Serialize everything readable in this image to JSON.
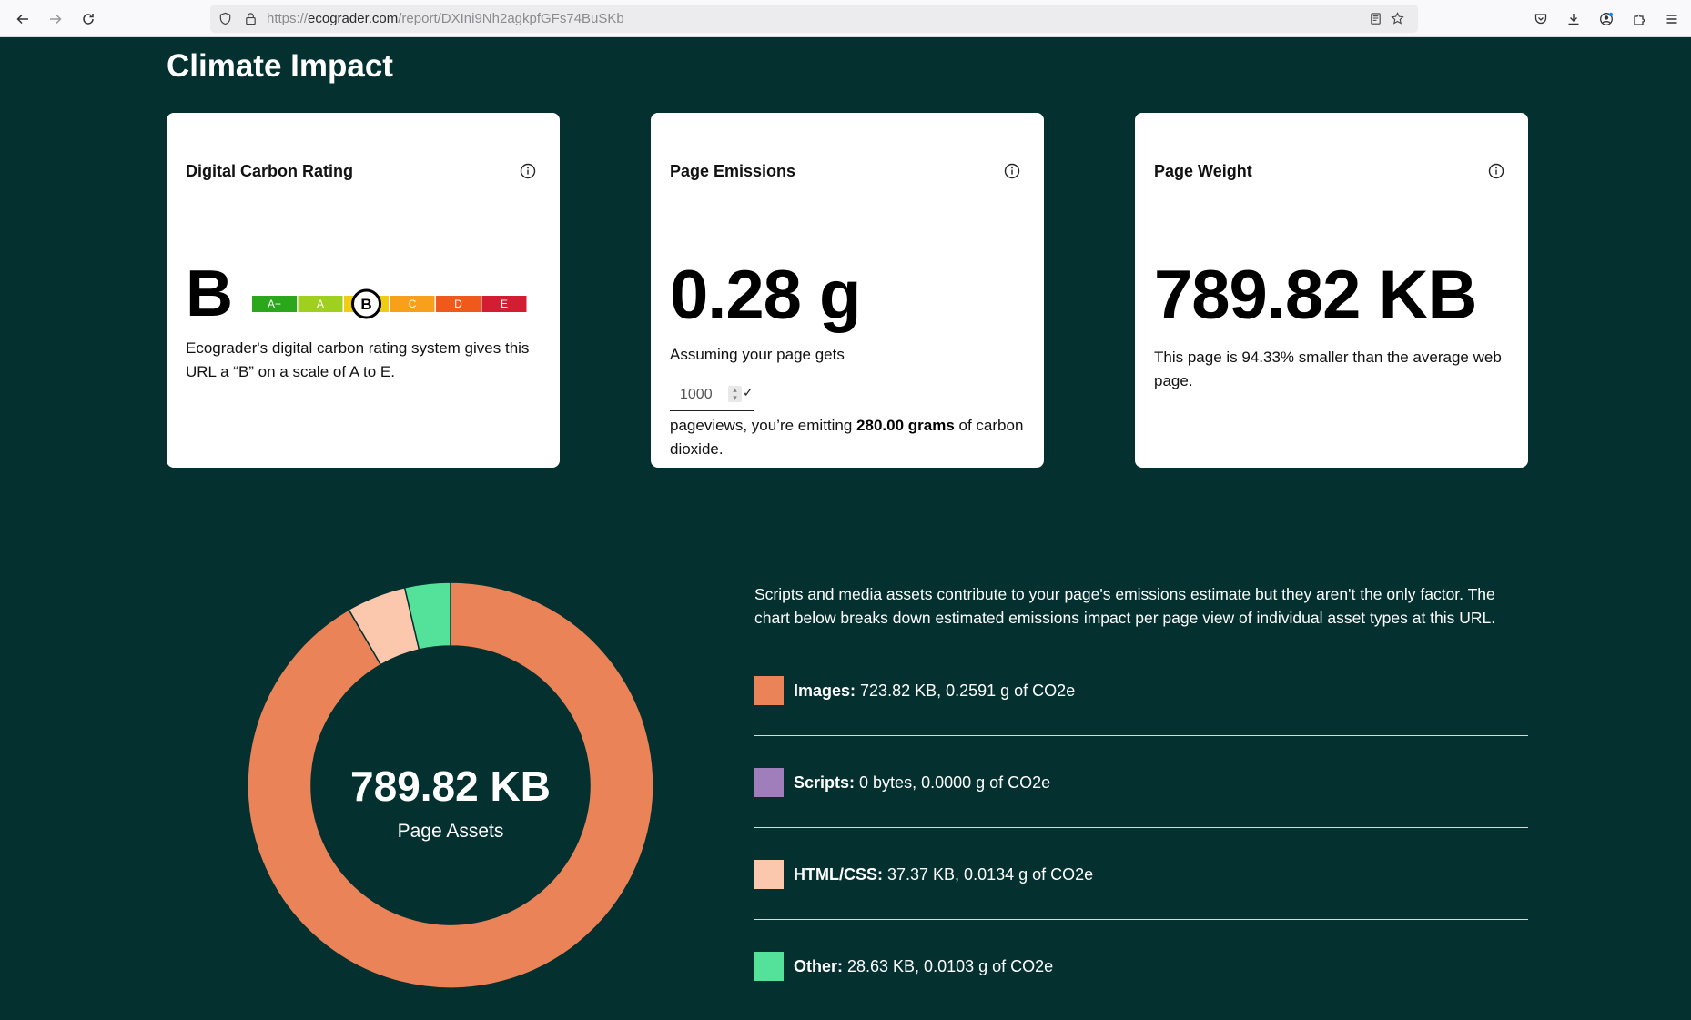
{
  "browser": {
    "url_scheme": "https://",
    "url_host": "ecograder.com",
    "url_path": "/report/DXIni9Nh2agkpfGFs74BuSKb"
  },
  "page": {
    "title": "Climate Impact"
  },
  "cards": {
    "rating": {
      "title": "Digital Carbon Rating",
      "letter": "B",
      "scale": [
        {
          "label": "A+",
          "color": "#2aa71a"
        },
        {
          "label": "A",
          "color": "#9fd01f"
        },
        {
          "label": "B",
          "color": "#f0cc12"
        },
        {
          "label": "C",
          "color": "#f8a01b"
        },
        {
          "label": "D",
          "color": "#ef5a1c"
        },
        {
          "label": "E",
          "color": "#d31d33"
        }
      ],
      "selected": "B",
      "text": "Ecograder's digital carbon rating system gives this URL a “B” on a scale of A to E."
    },
    "emissions": {
      "title": "Page Emissions",
      "value": "0.28 g",
      "assuming": "Assuming your page gets",
      "pageviews_value": "1000",
      "result_prefix": "pageviews, you’re emitting ",
      "result_bold": "280.00 grams",
      "result_suffix": " of carbon dioxide."
    },
    "weight": {
      "title": "Page Weight",
      "value": "789.82 KB",
      "text": "This page is 94.33% smaller than the average web page."
    }
  },
  "breakdown": {
    "description": "Scripts and media assets contribute to your page's emissions estimate but they aren't the only factor. The chart below breaks down estimated emissions impact per page view of individual asset types at this URL.",
    "donut_value": "789.82 KB",
    "donut_label": "Page Assets",
    "items": [
      {
        "name": "Images:",
        "detail": " 723.82 KB, 0.2591 g of CO2e",
        "color": "#ea8358"
      },
      {
        "name": "Scripts:",
        "detail": " 0 bytes, 0.0000 g of CO2e",
        "color": "#a07dbb"
      },
      {
        "name": "HTML/CSS:",
        "detail": " 37.37 KB, 0.0134 g of CO2e",
        "color": "#fcc8ad"
      },
      {
        "name": "Other:",
        "detail": " 28.63 KB, 0.0103 g of CO2e",
        "color": "#54e29b"
      }
    ]
  },
  "chart_data": {
    "type": "pie",
    "categories": [
      "Images",
      "Scripts",
      "HTML/CSS",
      "Other"
    ],
    "values": [
      723.82,
      0,
      37.37,
      28.63
    ],
    "units": "KB"
  }
}
